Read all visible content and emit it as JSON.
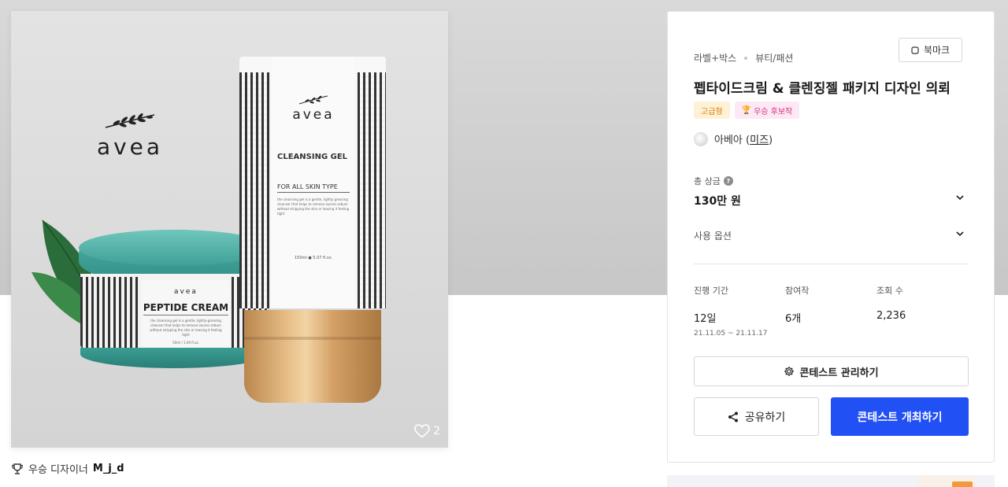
{
  "product_image": {
    "brand_logo_text": "avea",
    "jar_brand": "avea",
    "jar_product": "PEPTIDE CREAM",
    "jar_fine_print": "the cleansing gel is a gentle, lightly-greasing cleanser that helps to remove excess sebum without stripping the skin or leaving it feeling tight",
    "jar_volume": "50ml / 1.69 fl.oz.",
    "tube_brand": "avea",
    "tube_product": "CLEANSING GEL",
    "tube_skin_type": "FOR ALL SKIN TYPE",
    "tube_fine_print": "the cleansing gel is a gentle, lightly greasing cleanser that helps to remove excess sebum without stripping the skin or leaving it feeling tight",
    "tube_volume": "150ml ● 5.07 fl.oz.",
    "like_icon": "heart-icon",
    "like_count": "2"
  },
  "designer_caption": {
    "icon": "trophy-icon",
    "prefix": "우승 디자이너",
    "name": "M_j_d"
  },
  "panel": {
    "category": "라벨+박스",
    "subcategory": "뷰티/패션",
    "bookmark_label": "북마크",
    "title": "펩타이드크림 & 클렌징젤 패키지 디자인 의뢰",
    "badges": {
      "premium": "고급형",
      "winner": "우승 후보작"
    },
    "host_prefix": "아베아",
    "host_name": "미즈",
    "prize_label": "총 상금",
    "prize_value": "130만 원",
    "options_label": "사용 옵션",
    "stats": {
      "duration_label": "진행 기간",
      "duration_value": "12일",
      "duration_range": "21.11.05 ~ 21.11.17",
      "entries_label": "참여작",
      "entries_value": "6개",
      "views_label": "조회 수",
      "views_value": "2,236"
    },
    "manage_button": "콘테스트 관리하기",
    "share_button": "공유하기",
    "host_button": "콘테스트 개최하기"
  },
  "colors": {
    "primary": "#2150f5",
    "premium_badge_bg": "#fff1d6",
    "premium_badge_text": "#d4820a",
    "winner_badge_bg": "#fde9f3",
    "winner_badge_text": "#d62e86",
    "jar_teal": "#3fa097",
    "cap_gold": "#d4a066"
  }
}
